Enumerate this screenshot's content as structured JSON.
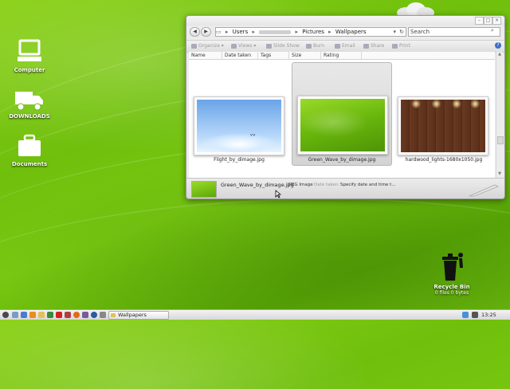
{
  "desktop": {
    "icons": [
      {
        "label": "Computer"
      },
      {
        "label": "DOWNLOADS"
      },
      {
        "label": "Documents"
      }
    ],
    "recycle_bin": {
      "label": "Recycle Bin",
      "sublabel": "0 files 0 bytes"
    }
  },
  "explorer": {
    "breadcrumb": [
      "Users",
      "Pictures",
      "Wallpapers"
    ],
    "search_placeholder": "Search",
    "toolbar": [
      "Organize",
      "Views",
      "Slide Show",
      "Burn",
      "Email",
      "Share",
      "Print"
    ],
    "columns": [
      "Name",
      "Date taken",
      "Tags",
      "Size",
      "Rating"
    ],
    "files": [
      {
        "name": "Flight_by_dimage.jpg"
      },
      {
        "name": "Green_Wave_by_dimage.jpg"
      },
      {
        "name": "hardwood_lights-1680x1050.jpg"
      }
    ],
    "status": {
      "filename": "Green_Wave_by_dimage.jpg",
      "type": "JPEG Image",
      "date_label": "Date taken:",
      "date_value": "Specify date and time t..."
    }
  },
  "taskbar": {
    "task_label": "Wallpapers",
    "clock": "13:25"
  },
  "colors": {
    "wallpaper_green": "#78c812",
    "selection": "#d9d9d9",
    "help_blue": "#3d6fc9"
  }
}
